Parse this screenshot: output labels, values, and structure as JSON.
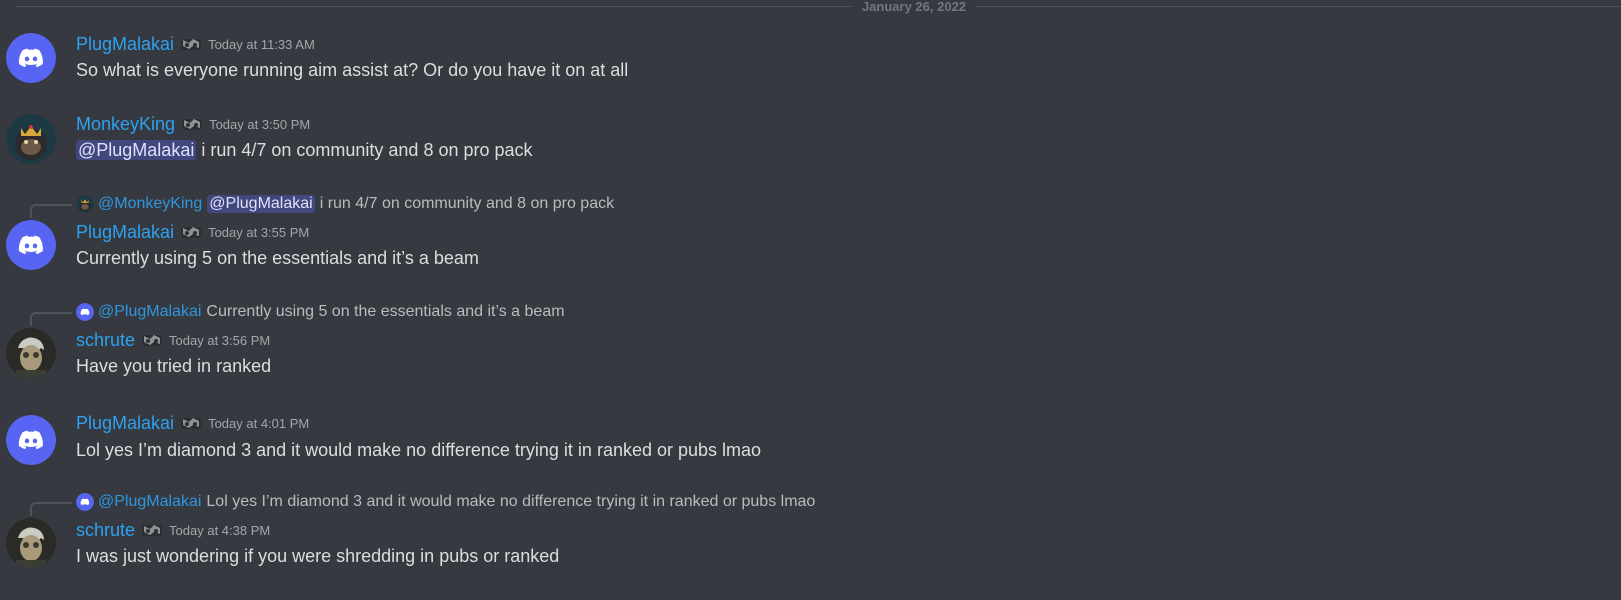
{
  "divider": {
    "date": "January 26, 2022"
  },
  "messages": [
    {
      "username": "PlugMalakai",
      "timestamp": "Today at 11:33 AM",
      "text": "So what is everyone running aim assist at? Or do you have it on at all",
      "avatar": "discord-logo"
    },
    {
      "username": "MonkeyKing",
      "timestamp": "Today at 3:50 PM",
      "mention": "@PlugMalakai",
      "text": " i run 4/7 on community and 8 on pro pack",
      "avatar": "monkey-avatar"
    },
    {
      "reply": {
        "name": "@MonkeyKing",
        "mention": "@PlugMalakai",
        "text": "i run 4/7 on community and 8 on pro pack"
      },
      "username": "PlugMalakai",
      "timestamp": "Today at 3:55 PM",
      "text": "Currently using 5 on the essentials and it’s a beam",
      "avatar": "discord-logo"
    },
    {
      "reply": {
        "name": "@PlugMalakai",
        "text": "Currently using 5 on the essentials and it’s a beam"
      },
      "username": "schrute",
      "timestamp": "Today at 3:56 PM",
      "text": "Have you tried in ranked",
      "avatar": "schrute-avatar"
    },
    {
      "username": "PlugMalakai",
      "timestamp": "Today at 4:01 PM",
      "text": "Lol yes I’m diamond 3 and it would make no difference trying it in ranked or pubs  lmao",
      "avatar": "discord-logo"
    },
    {
      "reply": {
        "name": "@PlugMalakai",
        "text": "Lol yes I’m diamond 3 and it would make no difference trying it in ranked or pubs  lmao"
      },
      "username": "schrute",
      "timestamp": "Today at 4:38 PM",
      "text": "I was just wondering if you were shredding in pubs or ranked",
      "avatar": "schrute-avatar"
    }
  ],
  "colors": {
    "background": "#36393f",
    "username": "#2ea2f0",
    "blurple": "#5865f2",
    "text": "#dcddde",
    "timestamp": "#a3a6aa"
  }
}
